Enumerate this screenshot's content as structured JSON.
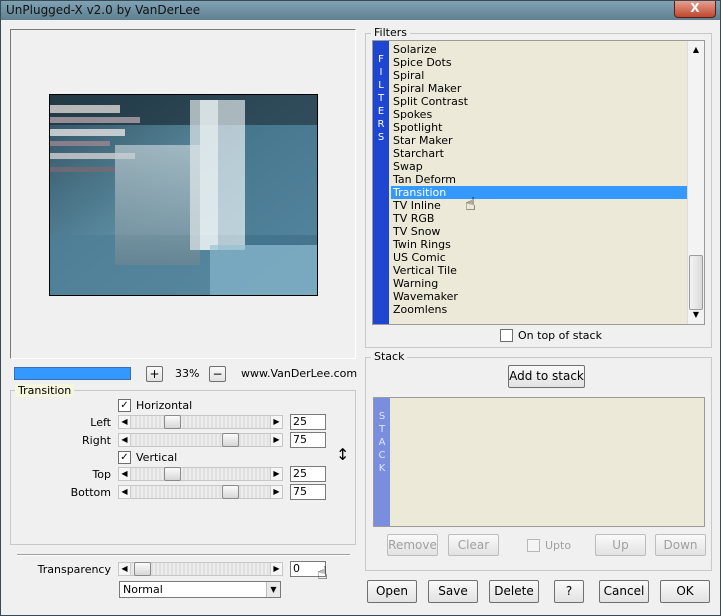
{
  "window": {
    "title": "UnPlugged-X v2.0 by VanDerLee",
    "close_label": "X"
  },
  "preview": {
    "zoom": "33%",
    "zoom_in": "+",
    "zoom_out": "−",
    "website": "www.VanDerLee.com",
    "progress": 1.0
  },
  "filters": {
    "group_label": "Filters",
    "band_text": "FILTERS",
    "items": [
      "Solarize",
      "Spice Dots",
      "Spiral",
      "Spiral Maker",
      "Split Contrast",
      "Spokes",
      "Spotlight",
      "Star Maker",
      "Starchart",
      "Swap",
      "Tan Deform",
      "Transition",
      "TV Inline",
      "TV RGB",
      "TV Snow",
      "Twin Rings",
      "US Comic",
      "Vertical Tile",
      "Warning",
      "Wavemaker",
      "Zoomlens"
    ],
    "selected": "Transition",
    "on_top_label": "On top of stack"
  },
  "transition": {
    "group_label": "Transition",
    "horizontal_label": "Horizontal",
    "horizontal_checked": true,
    "vertical_label": "Vertical",
    "vertical_checked": true,
    "left": {
      "label": "Left",
      "value": "25",
      "fraction": 0.25
    },
    "right": {
      "label": "Right",
      "value": "75",
      "fraction": 0.75
    },
    "top": {
      "label": "Top",
      "value": "25",
      "fraction": 0.25
    },
    "bottom": {
      "label": "Bottom",
      "value": "75",
      "fraction": 0.75
    },
    "link_icon": "vertical-double-arrow-icon"
  },
  "transparency": {
    "label": "Transparency",
    "value": "0",
    "fraction": 0.0
  },
  "blend_mode": {
    "selected": "Normal"
  },
  "stack": {
    "group_label": "Stack",
    "band_text": "STACK",
    "add_label": "Add to stack",
    "remove_label": "Remove",
    "clear_label": "Clear",
    "upto_label": "Upto",
    "up_label": "Up",
    "down_label": "Down"
  },
  "buttons": {
    "open": "Open",
    "save": "Save",
    "delete": "Delete",
    "help": "?",
    "cancel": "Cancel",
    "ok": "OK"
  },
  "colors": {
    "selection": "#3399ff",
    "filters_band": "#1f46d1",
    "stack_band": "#7a8ee0"
  }
}
